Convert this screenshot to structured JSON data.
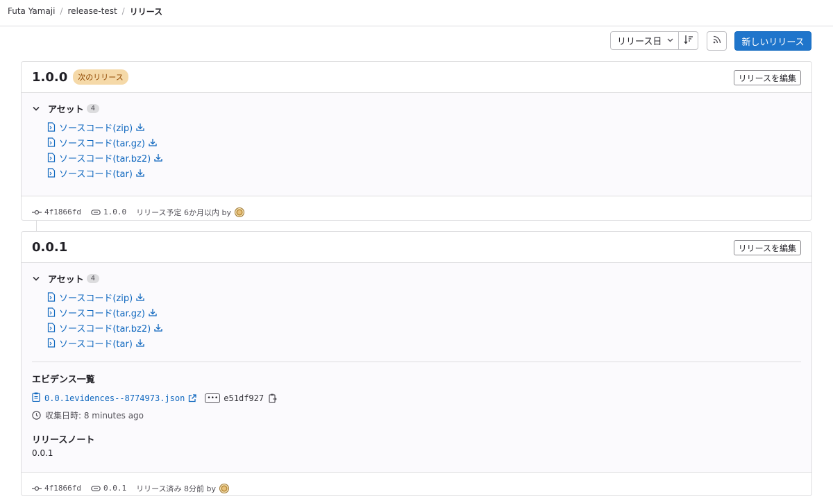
{
  "breadcrumb": [
    "Futa Yamaji",
    "release-test",
    "リリース"
  ],
  "toolbar": {
    "sort_label": "リリース日",
    "new_release": "新しいリリース"
  },
  "colors": {
    "primary": "#1f75cb",
    "link": "#1068bf",
    "upcoming_badge_bg": "#f5d9a8"
  },
  "releases": [
    {
      "tag": "1.0.0",
      "badge": "次のリリース",
      "edit_label": "リリースを編集",
      "assets_label": "アセット",
      "assets_count": "4",
      "assets": [
        "ソースコード(zip)",
        "ソースコード(tar.gz)",
        "ソースコード(tar.bz2)",
        "ソースコード(tar)"
      ],
      "commit": "4f1866fd",
      "tag_ref": "1.0.0",
      "status": "リリース予定 6か月以内 by"
    },
    {
      "tag": "0.0.1",
      "edit_label": "リリースを編集",
      "assets_label": "アセット",
      "assets_count": "4",
      "assets": [
        "ソースコード(zip)",
        "ソースコード(tar.gz)",
        "ソースコード(tar.bz2)",
        "ソースコード(tar)"
      ],
      "evidence_title": "エビデンス一覧",
      "evidence_file": "0.0.1evidences--8774973.json",
      "evidence_sha": "e51df927",
      "collected": "収集日時: 8 minutes ago",
      "notes_title": "リリースノート",
      "notes": "0.0.1",
      "commit": "4f1866fd",
      "tag_ref": "0.0.1",
      "status": "リリース済み 8分前 by"
    }
  ]
}
